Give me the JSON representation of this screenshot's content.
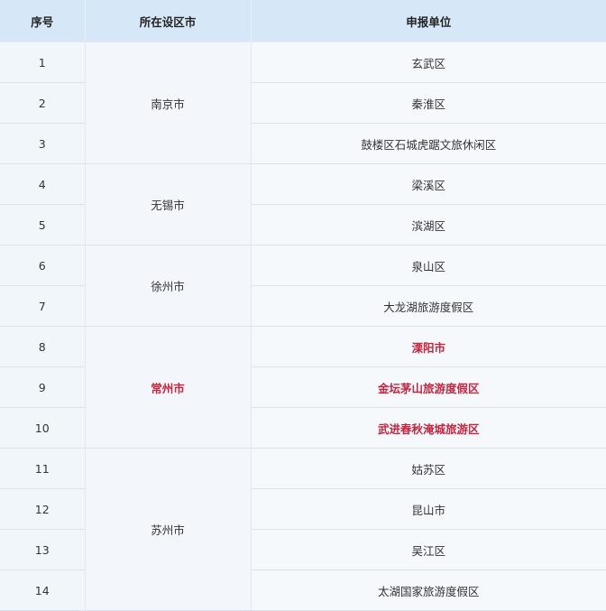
{
  "headers": {
    "index": "序号",
    "city": "所在设区市",
    "unit": "申报单位"
  },
  "cities": {
    "nanjing": "南京市",
    "wuxi": "无锡市",
    "xuzhou": "徐州市",
    "changzhou": "常州市",
    "suzhou": "苏州市"
  },
  "rows": [
    {
      "no": "1",
      "unit": "玄武区"
    },
    {
      "no": "2",
      "unit": "秦淮区"
    },
    {
      "no": "3",
      "unit": "鼓楼区石城虎踞文旅休闲区"
    },
    {
      "no": "4",
      "unit": "梁溪区"
    },
    {
      "no": "5",
      "unit": "滨湖区"
    },
    {
      "no": "6",
      "unit": "泉山区"
    },
    {
      "no": "7",
      "unit": "大龙湖旅游度假区"
    },
    {
      "no": "8",
      "unit": "溧阳市"
    },
    {
      "no": "9",
      "unit": "金坛茅山旅游度假区"
    },
    {
      "no": "10",
      "unit": "武进春秋淹城旅游区"
    },
    {
      "no": "11",
      "unit": "姑苏区"
    },
    {
      "no": "12",
      "unit": "昆山市"
    },
    {
      "no": "13",
      "unit": "吴江区"
    },
    {
      "no": "14",
      "unit": "太湖国家旅游度假区"
    }
  ],
  "colors": {
    "highlight": "#c8243e",
    "header_bg": "#d6e8f7"
  }
}
